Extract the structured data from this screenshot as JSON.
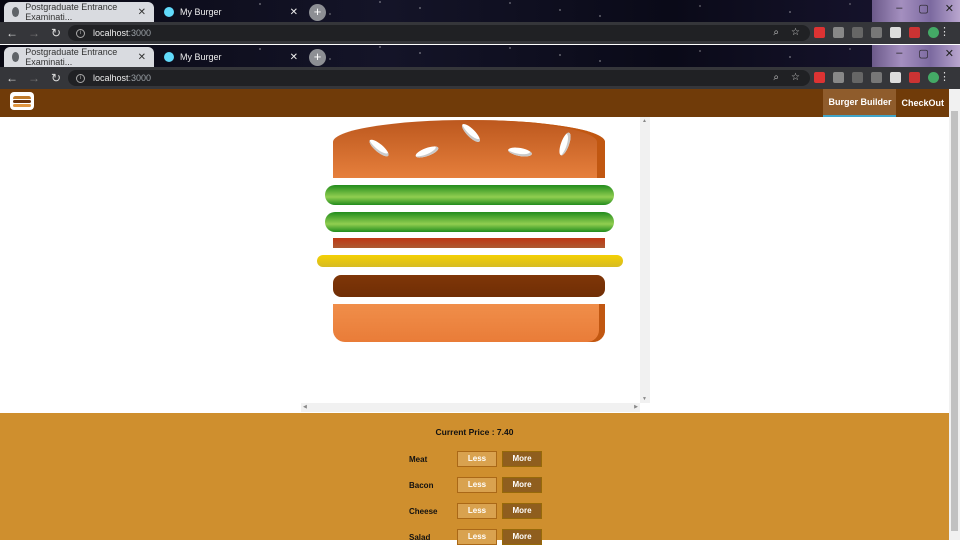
{
  "browser": {
    "tabs": [
      {
        "title": "Postgraduate Entrance Examinati...",
        "close": "✕"
      },
      {
        "title": "My Burger",
        "close": "✕"
      }
    ],
    "new_tab": "+",
    "url_host": "localhost",
    "url_port": ":3000",
    "nav": {
      "back": "←",
      "forward": "→",
      "reload": "↻"
    },
    "window_buttons": {
      "minimize": "–",
      "maximize": "▢",
      "close": "✕"
    },
    "omnibox_icons": {
      "zoom": "⌕",
      "bookmark": "☆"
    },
    "menu": "⋮"
  },
  "app": {
    "nav_items": [
      {
        "label": "Burger Builder",
        "active": true
      },
      {
        "label": "CheckOut",
        "active": false
      }
    ],
    "controls": {
      "price_label": "Current Price : 7.40",
      "rows": [
        {
          "label": "Meat",
          "less": "Less",
          "more": "More"
        },
        {
          "label": "Bacon",
          "less": "Less",
          "more": "More"
        },
        {
          "label": "Cheese",
          "less": "Less",
          "more": "More"
        },
        {
          "label": "Salad",
          "less": "Less",
          "more": "More"
        }
      ]
    }
  },
  "colors": {
    "toolbar_bg": "#703b09",
    "controls_bg": "#cf8f2e",
    "more_button": "#8f5e1e",
    "less_button": "#d9a24f",
    "active_nav_border": "#40a4c8"
  }
}
